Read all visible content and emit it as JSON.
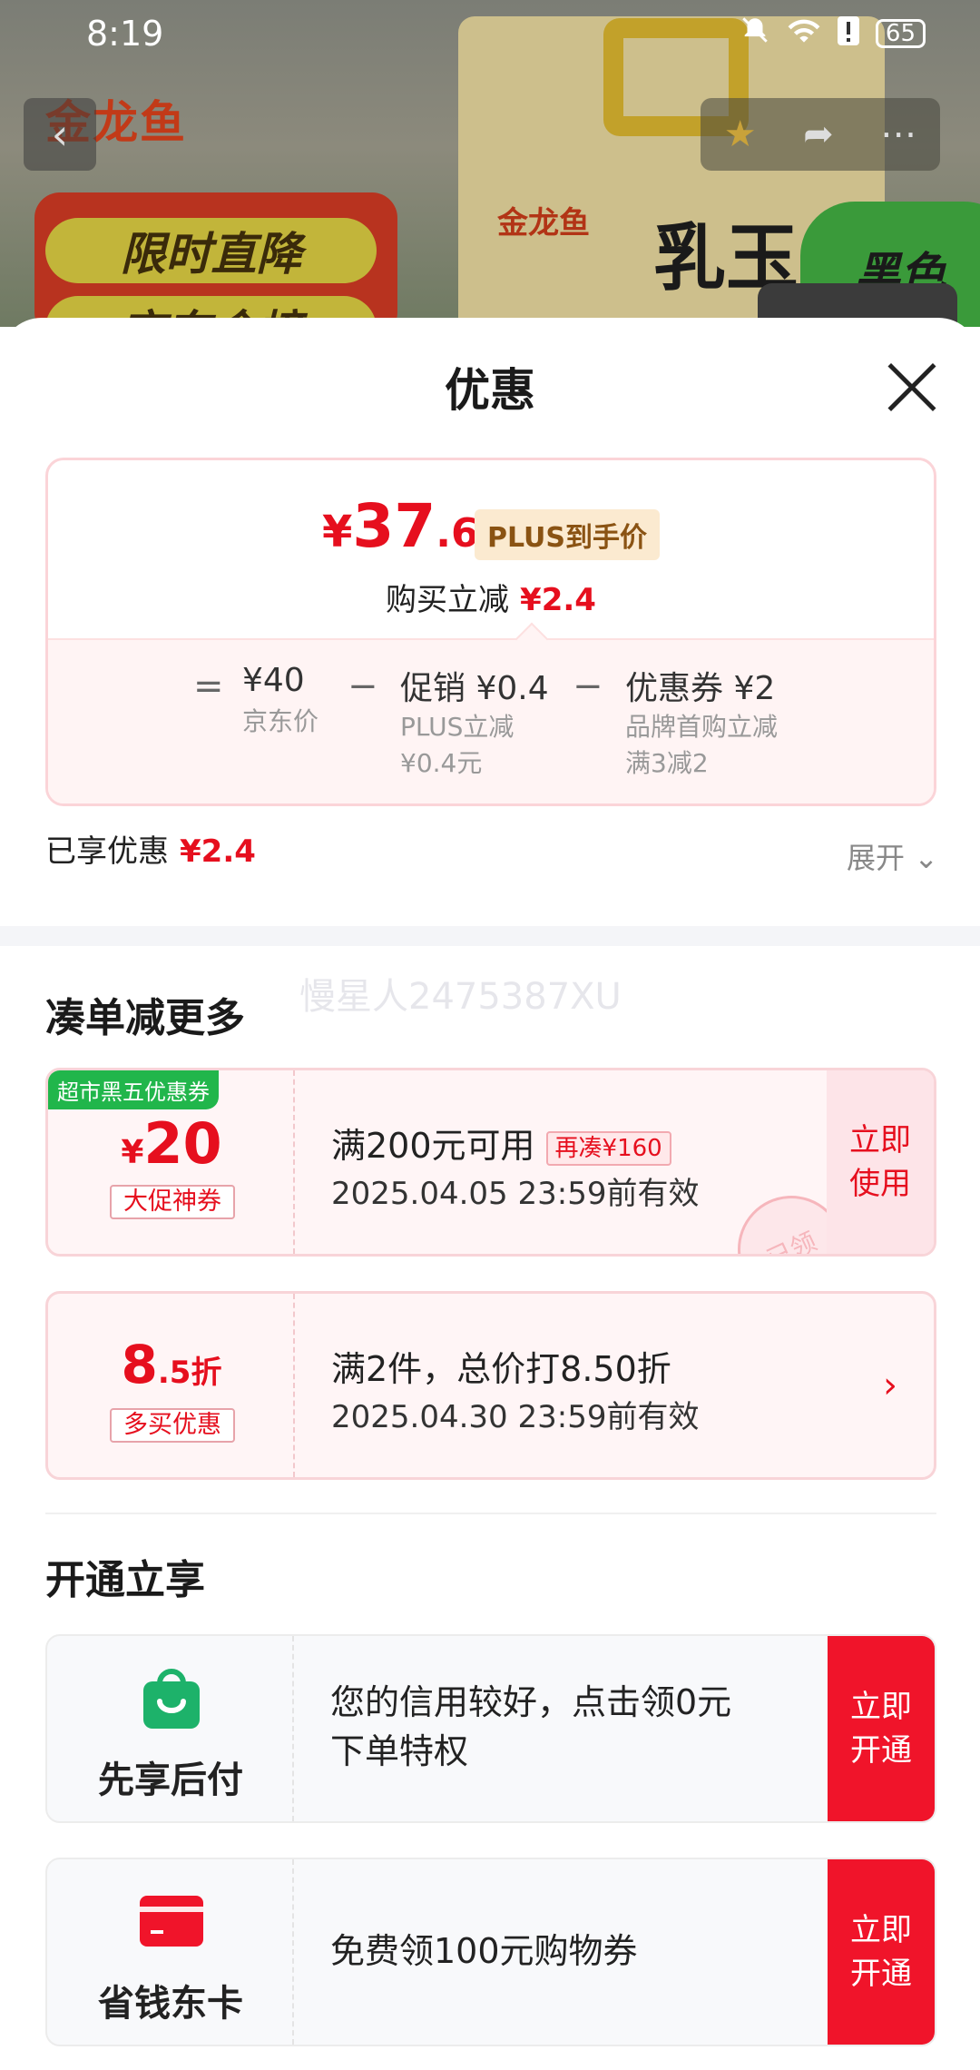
{
  "status_bar": {
    "time": "8:19",
    "battery": "65"
  },
  "background": {
    "brand": "金龙鱼",
    "promo_line1": "限时直降",
    "promo_line2": "京东金榜",
    "bag_brand": "金龙鱼",
    "bag_text": "乳玉",
    "green_label": "黑色"
  },
  "sheet": {
    "title": "优惠",
    "price": {
      "currency": "¥",
      "integer": "37",
      "decimal": ".6",
      "plus_tag": "PLUS到手价",
      "discount_label": "购买立减",
      "discount_value": "¥2.4"
    },
    "breakdown": {
      "eq": "=",
      "base_price": "¥40",
      "base_label": "京东价",
      "minus1": "−",
      "promo_label": "促销",
      "promo_value": "¥0.4",
      "promo_detail_1": "PLUS立减",
      "promo_detail_2": "¥0.4元",
      "minus2": "−",
      "coupon_label": "优惠券",
      "coupon_value": "¥2",
      "coupon_detail_1": "品牌首购立减",
      "coupon_detail_2": "满3减2"
    },
    "enjoyed_label": "已享优惠",
    "enjoyed_value": "¥2.4",
    "expand_label": "展开",
    "section1_title": "凑单减更多",
    "watermark": "慢星人2475387XU",
    "coupon1": {
      "tag": "超市黑五优惠券",
      "currency": "¥",
      "amount": "20",
      "label": "大促神券",
      "condition": "满200元可用",
      "again": "再凑¥160",
      "validity": "2025.04.05 23:59前有效",
      "action_line1": "立即",
      "action_line2": "使用",
      "stamp": "已领"
    },
    "coupon2": {
      "amount": "8",
      "amount_dec": ".5折",
      "label": "多买优惠",
      "condition": "满2件，总价打8.50折",
      "validity": "2025.04.30 23:59前有效"
    },
    "section2_title": "开通立享",
    "service1": {
      "name": "先享后付",
      "text_line1": "您的信用较好，点击领0元",
      "text_line2": "下单特权",
      "action_line1": "立即",
      "action_line2": "开通"
    },
    "service2": {
      "name": "省钱东卡",
      "text": "免费领100元购物券",
      "action_line1": "立即",
      "action_line2": "开通"
    }
  },
  "colors": {
    "accent_red": "#e60f1e",
    "tag_green": "#21b64b",
    "plus_gold": "#8a5313"
  }
}
